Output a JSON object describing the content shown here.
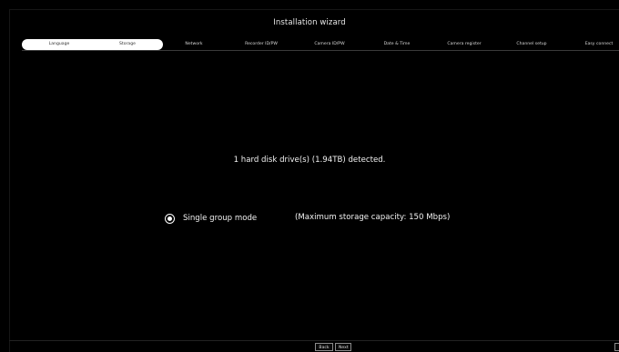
{
  "window": {
    "title": "Installation wizard"
  },
  "steps": [
    {
      "label": "Language",
      "state": "done"
    },
    {
      "label": "Storage",
      "state": "current"
    },
    {
      "label": "Network",
      "state": "pending"
    },
    {
      "label": "Recorder ID/PW",
      "state": "pending"
    },
    {
      "label": "Camera ID/PW",
      "state": "pending"
    },
    {
      "label": "Date & Time",
      "state": "pending"
    },
    {
      "label": "Camera register",
      "state": "pending"
    },
    {
      "label": "Channel setup",
      "state": "pending"
    },
    {
      "label": "Easy connect",
      "state": "pending"
    }
  ],
  "storage": {
    "detected_message": "1 hard disk drive(s) (1.94TB) detected.",
    "mode_label": "Single group mode",
    "mode_selected": true,
    "capacity_text": "(Maximum storage capacity: 150 Mbps)"
  },
  "footer": {
    "back_label": "Back",
    "next_label": "Next"
  },
  "colors": {
    "background": "#000000",
    "text": "#ffffff",
    "progress_fill": "#ffffff"
  }
}
